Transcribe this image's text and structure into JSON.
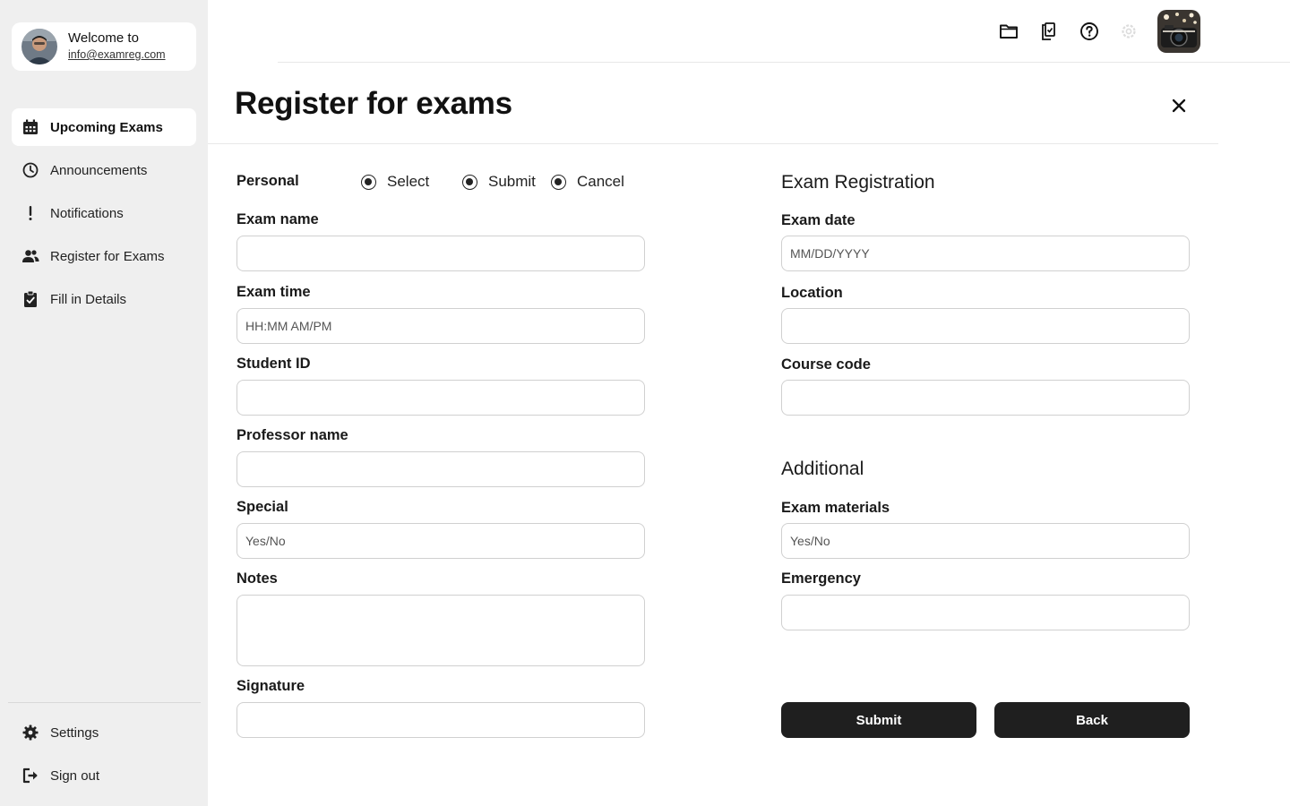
{
  "profile": {
    "welcome": "Welcome to",
    "email": "info@examreg.com"
  },
  "sidebar": {
    "items": [
      {
        "label": "Upcoming Exams",
        "icon": "calendar-icon",
        "active": true
      },
      {
        "label": "Announcements",
        "icon": "clock-icon"
      },
      {
        "label": "Notifications",
        "icon": "exclamation-icon"
      },
      {
        "label": "Register for Exams",
        "icon": "users-icon"
      },
      {
        "label": "Fill in Details",
        "icon": "clipboard-check-icon"
      }
    ],
    "bottom": [
      {
        "label": "Settings",
        "icon": "gear-icon"
      },
      {
        "label": "Sign out",
        "icon": "sign-out-icon"
      }
    ]
  },
  "topbar": {
    "icons": [
      "folder-icon",
      "clipboard-icon",
      "help-icon",
      "settings-icon",
      "user-avatar"
    ]
  },
  "page": {
    "title": "Register for exams"
  },
  "form": {
    "personal_label": "Personal",
    "radios": [
      "Select",
      "Submit",
      "Cancel"
    ],
    "left": {
      "exam_name": {
        "label": "Exam name",
        "placeholder": ""
      },
      "exam_time": {
        "label": "Exam time",
        "placeholder": "HH:MM AM/PM"
      },
      "student_id": {
        "label": "Student ID",
        "placeholder": ""
      },
      "professor_name": {
        "label": "Professor name",
        "placeholder": ""
      },
      "special": {
        "label": "Special",
        "placeholder": "Yes/No"
      },
      "notes": {
        "label": "Notes",
        "placeholder": ""
      },
      "signature": {
        "label": "Signature",
        "placeholder": ""
      }
    },
    "right": {
      "section1": "Exam Registration",
      "exam_date": {
        "label": "Exam date",
        "placeholder": "MM/DD/YYYY"
      },
      "location": {
        "label": "Location",
        "placeholder": ""
      },
      "course_code": {
        "label": "Course code",
        "placeholder": ""
      },
      "section2": "Additional",
      "exam_materials": {
        "label": "Exam materials",
        "placeholder": "Yes/No"
      },
      "emergency": {
        "label": "Emergency",
        "placeholder": ""
      }
    },
    "buttons": {
      "submit": "Submit",
      "back": "Back"
    }
  }
}
